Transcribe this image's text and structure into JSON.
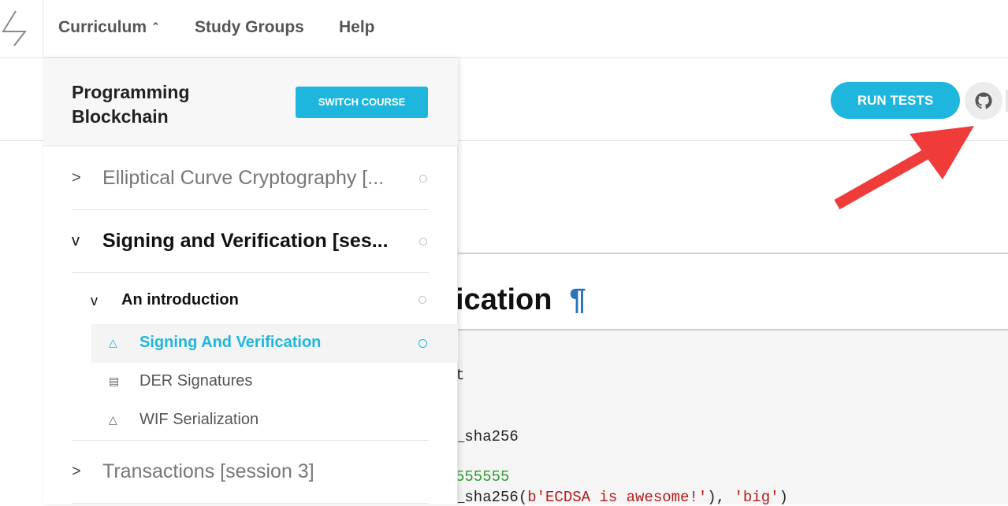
{
  "nav": {
    "items": [
      {
        "label": "Curriculum",
        "caret": "^"
      },
      {
        "label": "Study Groups"
      },
      {
        "label": "Help"
      }
    ]
  },
  "toolbar": {
    "run_tests_label": "RUN TESTS",
    "github_icon": "github-icon"
  },
  "content": {
    "heading_visible": "ication",
    "pilcrow": "¶",
    "code_lines": [
      "t",
      "_sha256",
      "555555",
      "_sha256(",
      "b'ECDSA is awesome!'",
      "), ",
      "'big'",
      ")"
    ]
  },
  "curriculum_panel": {
    "course_title": "Programming Blockchain",
    "switch_course_label": "SWITCH COURSE",
    "sections": [
      {
        "chevron": ">",
        "title": "Elliptical Curve Cryptography [..."
      },
      {
        "chevron": "v",
        "title": "Signing and Verification [ses..."
      },
      {
        "chevron": ">",
        "title": "Transactions [session 3]"
      }
    ],
    "subsection": {
      "title": "An introduction"
    },
    "lessons": [
      {
        "title": "Signing And Verification",
        "icon": "flask-icon"
      },
      {
        "title": "DER Signatures",
        "icon": "book-icon"
      },
      {
        "title": "WIF Serialization",
        "icon": "flask-icon"
      }
    ]
  },
  "colors": {
    "accent": "#1fb6dd",
    "arrow": "#f03b3b"
  }
}
